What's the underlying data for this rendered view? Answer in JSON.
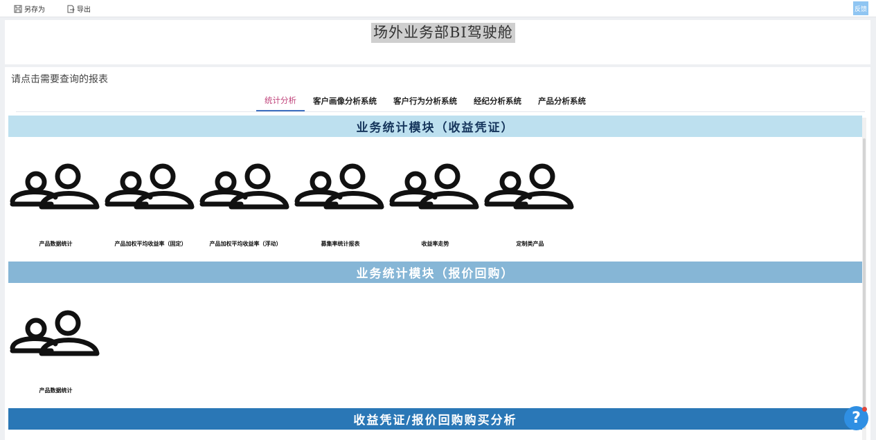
{
  "toolbar": {
    "save_as_label": "另存为",
    "export_label": "导出",
    "feedback_label": "反馈"
  },
  "header": {
    "title": "场外业务部BI驾驶舱"
  },
  "main": {
    "hint": "请点击需要查询的报表",
    "tabs": [
      {
        "label": "统计分析",
        "active": true
      },
      {
        "label": "客户画像分析系统",
        "active": false
      },
      {
        "label": "客户行为分析系统",
        "active": false
      },
      {
        "label": "经纪分析系统",
        "active": false
      },
      {
        "label": "产品分析系统",
        "active": false
      }
    ]
  },
  "sections": [
    {
      "title": "业务统计模块（收益凭证）",
      "color": "#bde0ef",
      "items": [
        {
          "label": "产品数据统计",
          "icon": "users-icon"
        },
        {
          "label": "产品加权平均收益率（固定）",
          "icon": "users-icon"
        },
        {
          "label": "产品加权平均收益率（浮动）",
          "icon": "users-icon"
        },
        {
          "label": "募集率统计报表",
          "icon": "users-icon"
        },
        {
          "label": "收益率走势",
          "icon": "users-icon"
        },
        {
          "label": "定制类产品",
          "icon": "users-icon"
        }
      ]
    },
    {
      "title": "业务统计模块（报价回购）",
      "color": "#86b6d6",
      "items": [
        {
          "label": "产品数据统计",
          "icon": "users-icon"
        }
      ]
    },
    {
      "title": "收益凭证/报价回购购买分析",
      "color": "#2a77b6",
      "items": []
    }
  ],
  "help": {
    "label": "?"
  }
}
